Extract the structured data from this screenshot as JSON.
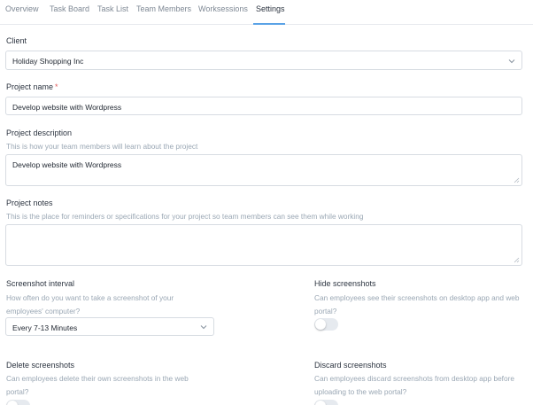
{
  "tabs": [
    {
      "label": "Overview",
      "active": false
    },
    {
      "label": "Task Board",
      "active": false
    },
    {
      "label": "Task List",
      "active": false
    },
    {
      "label": "Team Members",
      "active": false
    },
    {
      "label": "Worksessions",
      "active": false
    },
    {
      "label": "Settings",
      "active": true
    }
  ],
  "client": {
    "label": "Client",
    "value": "Holiday Shopping Inc"
  },
  "project_name": {
    "label": "Project name",
    "required_mark": "*",
    "value": "Develop website with Wordpress"
  },
  "project_description": {
    "label": "Project description",
    "help": "This is how your team members will learn about the project",
    "value": "Develop website with Wordpress"
  },
  "project_notes": {
    "label": "Project notes",
    "help": "This is the place for reminders or specifications for your project so team members can see them while working",
    "value": ""
  },
  "screenshot_interval": {
    "label": "Screenshot interval",
    "help": "How often do you want to take a screenshot of your employees' computer?",
    "value": "Every 7-13 Minutes"
  },
  "hide_screenshots": {
    "label": "Hide screenshots",
    "help": "Can employees see their screenshots on desktop app and web portal?",
    "enabled": false
  },
  "delete_screenshots": {
    "label": "Delete screenshots",
    "help": "Can employees delete their own screenshots in the web portal?",
    "enabled": false
  },
  "discard_screenshots": {
    "label": "Discard screenshots",
    "help": "Can employees discard screenshots from desktop app before uploading to the web portal?",
    "enabled": false
  },
  "colors": {
    "accent": "#5aa2e6",
    "required": "#e05c5c",
    "help_text": "#9aa7b4",
    "border": "#d7dce2"
  }
}
